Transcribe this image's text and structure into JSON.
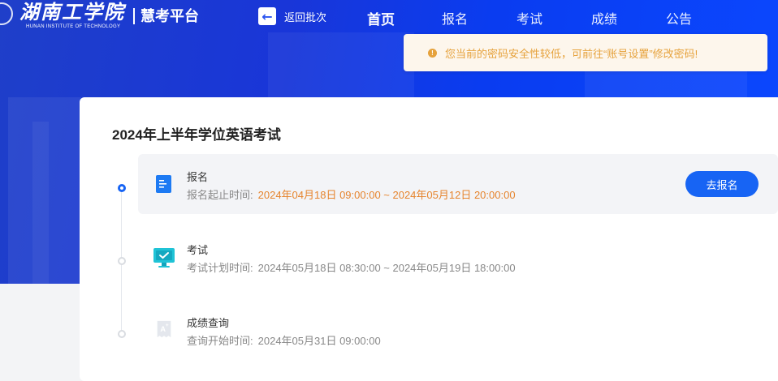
{
  "header": {
    "logo_text": "湖南工学院",
    "logo_subtext": "HUNAN INSTITUTE OF TECHNOLOGY",
    "platform_name": "慧考平台",
    "back_label": "返回批次",
    "nav": [
      {
        "label": "首页",
        "active": true
      },
      {
        "label": "报名",
        "active": false
      },
      {
        "label": "考试",
        "active": false
      },
      {
        "label": "成绩",
        "active": false
      },
      {
        "label": "公告",
        "active": false
      }
    ]
  },
  "notice": {
    "text": "您当前的密码安全性较低，可前往“账号设置”修改密码!",
    "color": "#e6a23c"
  },
  "exam": {
    "title": "2024年上半年学位英语考试",
    "steps": [
      {
        "name": "报名",
        "time_label": "报名起止时间:",
        "time_value": "2024年04月18日 09:00:00 ~ 2024年05月12日 20:00:00",
        "icon": "registration-icon",
        "button": "去报名"
      },
      {
        "name": "考试",
        "time_label": "考试计划时间:",
        "time_value": "2024年05月18日 08:30:00 ~ 2024年05月19日 18:00:00",
        "icon": "monitor-check-icon"
      },
      {
        "name": "成绩查询",
        "time_label": "查询开始时间:",
        "time_value": "2024年05月31日 09:00:00",
        "icon": "grade-certificate-icon"
      }
    ]
  },
  "colors": {
    "primary": "#1764f4",
    "highlight_time": "#e6842d"
  }
}
